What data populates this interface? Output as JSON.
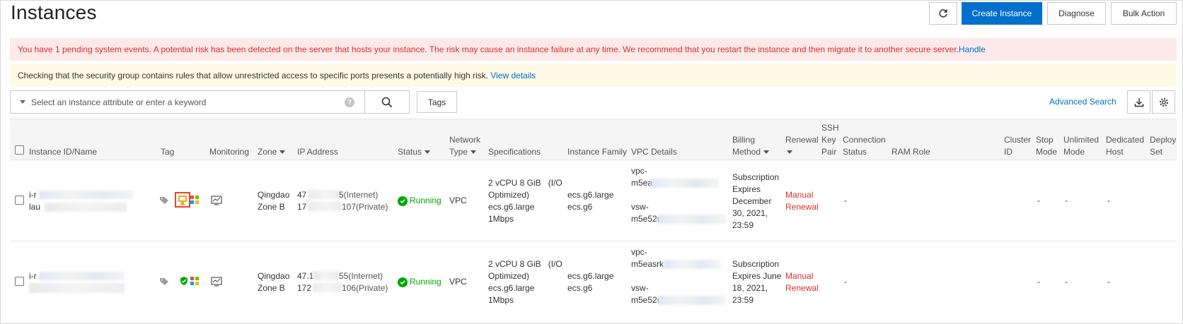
{
  "header": {
    "title": "Instances",
    "refresh_icon": "refresh-icon",
    "create_label": "Create Instance",
    "diagnose_label": "Diagnose",
    "bulk_label": "Bulk Action"
  },
  "alerts": {
    "red_text": "You have 1 pending system events. A potential risk has been detected on the server that hosts your instance. The risk may cause an instance failure at any time. We recommend that you restart the instance and then migrate it to another secure server.",
    "red_link": "Handle",
    "yellow_text": "Checking that the security group contains rules that allow unrestricted access to specific ports presents a potentially high risk.",
    "yellow_link": "View details"
  },
  "toolbar": {
    "search_placeholder": "Select an instance attribute or enter a keyword",
    "tags_label": "Tags",
    "advanced_search": "Advanced Search"
  },
  "columns": {
    "instance": "Instance ID/Name",
    "tag": "Tag",
    "monitoring": "Monitoring",
    "zone": "Zone",
    "ip": "IP Address",
    "status": "Status",
    "network_1": "Network",
    "network_2": "Type",
    "specs": "Specifications",
    "family": "Instance Family",
    "vpc": "VPC Details",
    "billing_1": "Billing",
    "billing_2": "Method",
    "renewal": "Renewal",
    "ssh_1": "SSH",
    "ssh_2": "Key",
    "ssh_3": "Pair",
    "conn_1": "Connection",
    "conn_2": "Status",
    "ram": "RAM Role",
    "cluster_1": "Cluster",
    "cluster_2": "ID",
    "stop_1": "Stop",
    "stop_2": "Mode",
    "unlim_1": "Unlimited",
    "unlim_2": "Mode",
    "dedicated_1": "Dedicated",
    "dedicated_2": "Host",
    "deploy_1": "Deploy",
    "deploy_2": "Set"
  },
  "rows": [
    {
      "id_prefix": "i-r",
      "name_prefix": "lau",
      "zone_1": "Qingdao",
      "zone_2": "Zone B",
      "ip_pub_prefix": "47",
      "ip_pub_suffix": "5(Internet)",
      "ip_priv_prefix": "17",
      "ip_priv_suffix": "107(Private)",
      "status": "Running",
      "network": "VPC",
      "spec_1": "2 vCPU 8 GiB",
      "spec_1b": "(I/O",
      "spec_2": "Optimized)",
      "spec_type": "ecs.g6.large",
      "spec_bw": "1Mbps",
      "family_1": "ecs.g6.large",
      "family_2": "ecs.g6",
      "vpc_label": "vpc-",
      "vpc_id": "m5ea",
      "vsw_label": "vsw-",
      "vsw_id": "m5e52u",
      "billing_1": "Subscription",
      "billing_2": "Expires",
      "billing_3": "December",
      "billing_4": "30, 2021,",
      "billing_5": "23:59",
      "renewal_1": "Manual",
      "renewal_2": "Renewal",
      "conn": "-",
      "stop": "-",
      "unlimited": "-",
      "dedicated": "-"
    },
    {
      "id_prefix": "i-r",
      "zone_1": "Qingdao",
      "zone_2": "Zone B",
      "ip_pub_prefix": "47.1",
      "ip_pub_suffix": "55(Internet)",
      "ip_priv_prefix": "172",
      "ip_priv_suffix": "106(Private)",
      "status": "Running",
      "network": "VPC",
      "spec_1": "2 vCPU 8 GiB",
      "spec_1b": "(I/O",
      "spec_2": "Optimized)",
      "spec_type": "ecs.g6.large",
      "spec_bw": "1Mbps",
      "family_1": "ecs.g6.large",
      "family_2": "ecs.g6",
      "vpc_label": "vpc-",
      "vpc_id": "m5easrk",
      "vsw_label": "vsw-",
      "vsw_id": "m5e52u",
      "billing_1": "Subscription",
      "billing_2": "Expires June",
      "billing_3": "18, 2021,",
      "billing_4": "23:59",
      "renewal_1": "Manual",
      "renewal_2": "Renewal",
      "conn": "-",
      "stop": "-",
      "unlimited": "-",
      "dedicated": "-"
    }
  ]
}
